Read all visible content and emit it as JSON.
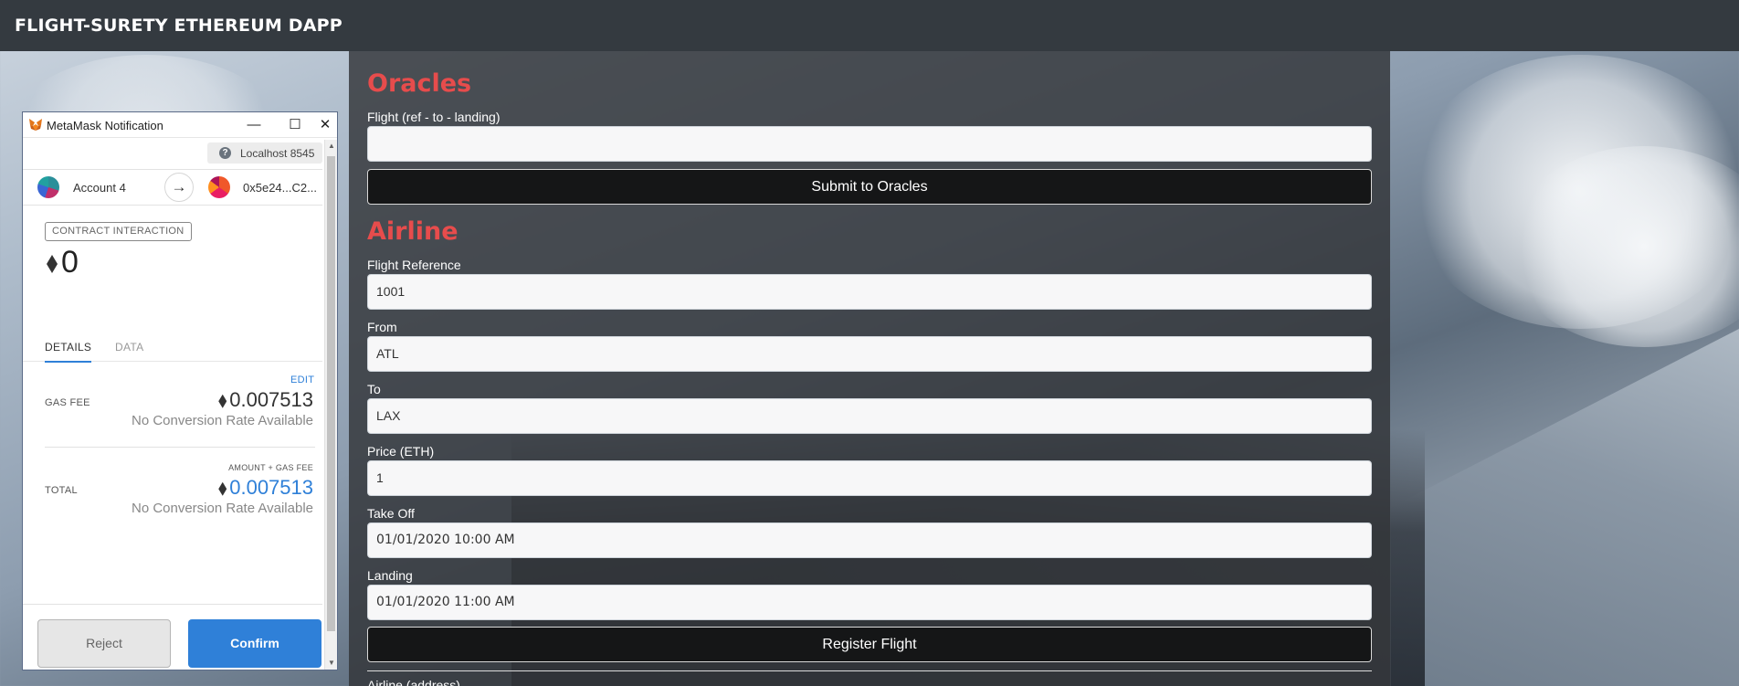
{
  "navbar": {
    "brand": "FLIGHT-SURETY ETHEREUM DAPP"
  },
  "oracles": {
    "title": "Oracles",
    "flight_label": "Flight (ref - to - landing)",
    "flight_value": "",
    "submit_label": "Submit to Oracles"
  },
  "airline": {
    "title": "Airline",
    "fields": [
      {
        "label": "Flight Reference",
        "value": "1001"
      },
      {
        "label": "From",
        "value": "ATL"
      },
      {
        "label": "To",
        "value": "LAX"
      },
      {
        "label": "Price (ETH)",
        "value": "1"
      },
      {
        "label": "Take Off",
        "value": "01/01/2020 10:00 AM"
      },
      {
        "label": "Landing",
        "value": "01/01/2020 11:00 AM"
      }
    ],
    "register_label": "Register Flight",
    "next_label": "Airline (address)"
  },
  "metamask": {
    "window_title": "MetaMask Notification",
    "network": "Localhost 8545",
    "from_account": "Account 4",
    "to_account": "0x5e24...C2...",
    "badge": "CONTRACT INTERACTION",
    "amount": "0",
    "tabs": [
      "DETAILS",
      "DATA"
    ],
    "edit_label": "EDIT",
    "gas_fee_label": "GAS FEE",
    "gas_fee_value": "0.007513",
    "conversion_text": "No Conversion Rate Available",
    "amount_gas_label": "AMOUNT + GAS FEE",
    "total_label": "TOTAL",
    "total_value": "0.007513",
    "reject_label": "Reject",
    "confirm_label": "Confirm"
  },
  "colors": {
    "accent_red": "#e74c4c",
    "metamask_blue": "#2f80d8",
    "navbar": "#343a40"
  }
}
